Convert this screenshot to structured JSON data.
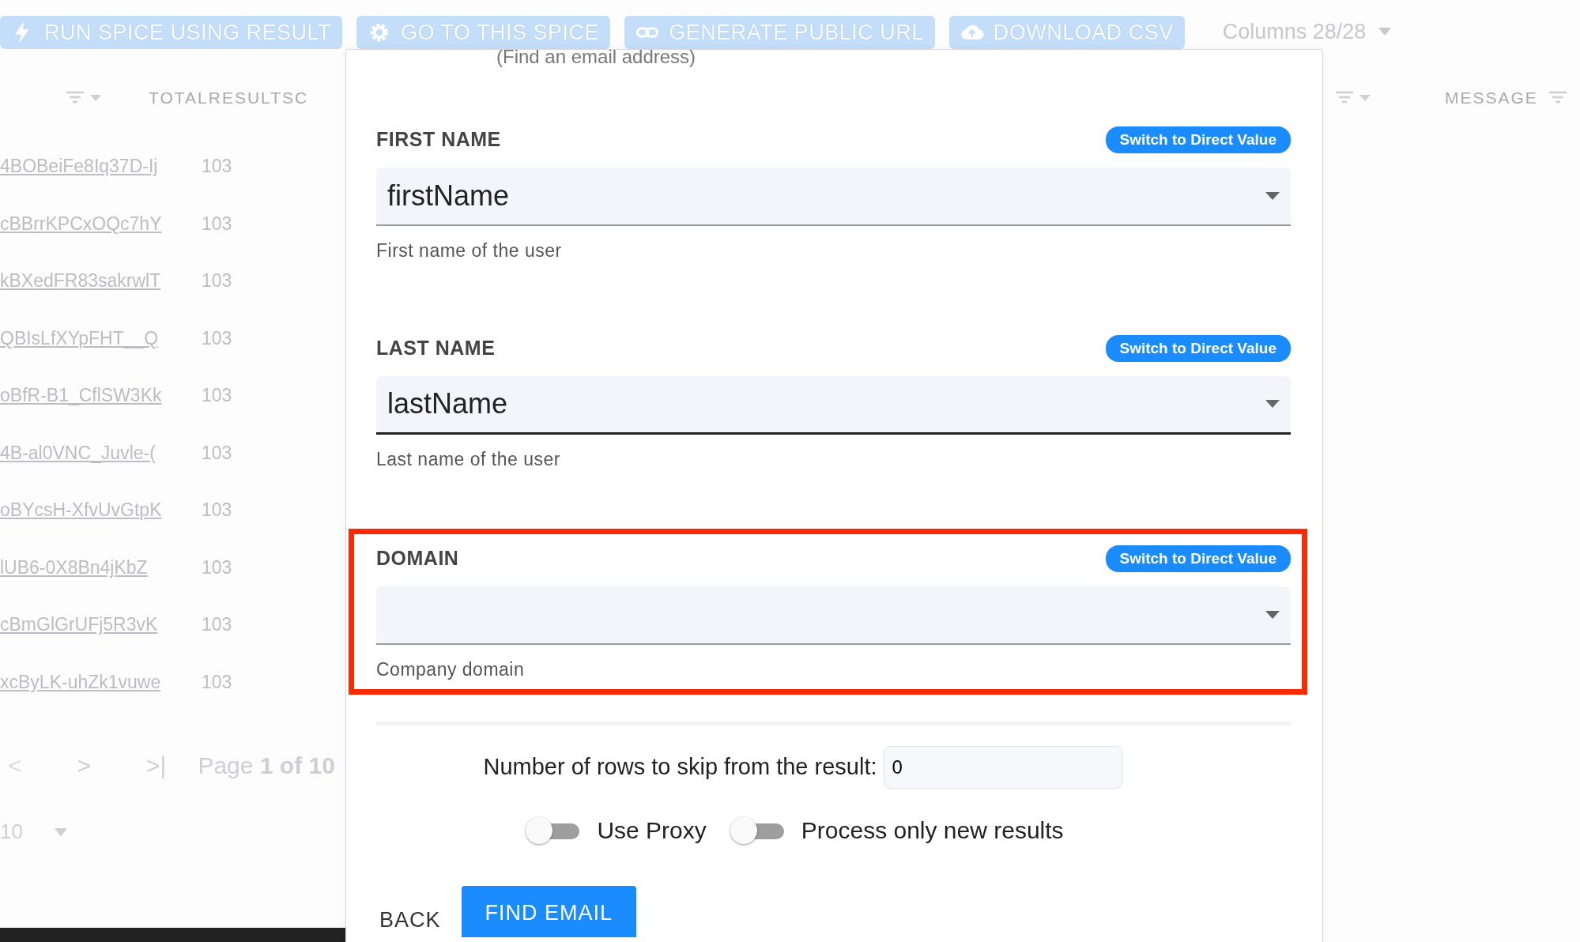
{
  "toolbar": {
    "buttons": [
      {
        "label": "RUN SPICE USING RESULT"
      },
      {
        "label": "GO TO THIS SPICE"
      },
      {
        "label": "GENERATE PUBLIC URL"
      },
      {
        "label": "DOWNLOAD CSV"
      }
    ],
    "columns_menu": "Columns 28/28"
  },
  "table": {
    "columns": [
      {
        "label": "TOTALRESULTSC"
      }
    ],
    "right_columns": [
      {
        "label": "MESSAGE"
      }
    ],
    "rows": [
      {
        "id": "4BOBeiFe8Iq37D-Ij",
        "total": "103"
      },
      {
        "id": "cBBrrKPCxOQc7hY",
        "total": "103"
      },
      {
        "id": "kBXedFR83sakrwlT",
        "total": "103"
      },
      {
        "id": "QBIsLfXYpFHT__Q",
        "total": "103"
      },
      {
        "id": "oBfR-B1_CflSW3Kk",
        "total": "103"
      },
      {
        "id": "4B-al0VNC_Juvle-(",
        "total": "103"
      },
      {
        "id": "oBYcsH-XfvUvGtpK",
        "total": "103"
      },
      {
        "id": "lUB6-0X8Bn4jKbZ",
        "total": "103"
      },
      {
        "id": "cBmGlGrUFj5R3vK",
        "total": "103"
      },
      {
        "id": "xcByLK-uhZk1vuwe",
        "total": "103"
      }
    ]
  },
  "pagination": {
    "prev": "<",
    "next": ">",
    "last": ">|",
    "page_text": "Page **1 of 10**",
    "page_size": "10"
  },
  "dialog": {
    "subtitle": "(Find an email address)",
    "fields": [
      {
        "label": "FIRST NAME",
        "switch": "Switch to Direct Value",
        "value": "firstName",
        "help": "First name of the user",
        "focused": false,
        "highlighted": false
      },
      {
        "label": "LAST NAME",
        "switch": "Switch to Direct Value",
        "value": "lastName",
        "help": "Last name of the user",
        "focused": true,
        "highlighted": false
      },
      {
        "label": "DOMAIN",
        "switch": "Switch to Direct Value",
        "help": "Company domain",
        "focused": false,
        "highlighted": true
      }
    ],
    "skip_label": "Number of rows to skip from the result:",
    "skip_value": "0",
    "toggles": [
      {
        "label": "Use Proxy",
        "on": false
      },
      {
        "label": "Process only new results",
        "on": false
      }
    ],
    "back": "BACK",
    "submit": "FIND EMAIL"
  }
}
